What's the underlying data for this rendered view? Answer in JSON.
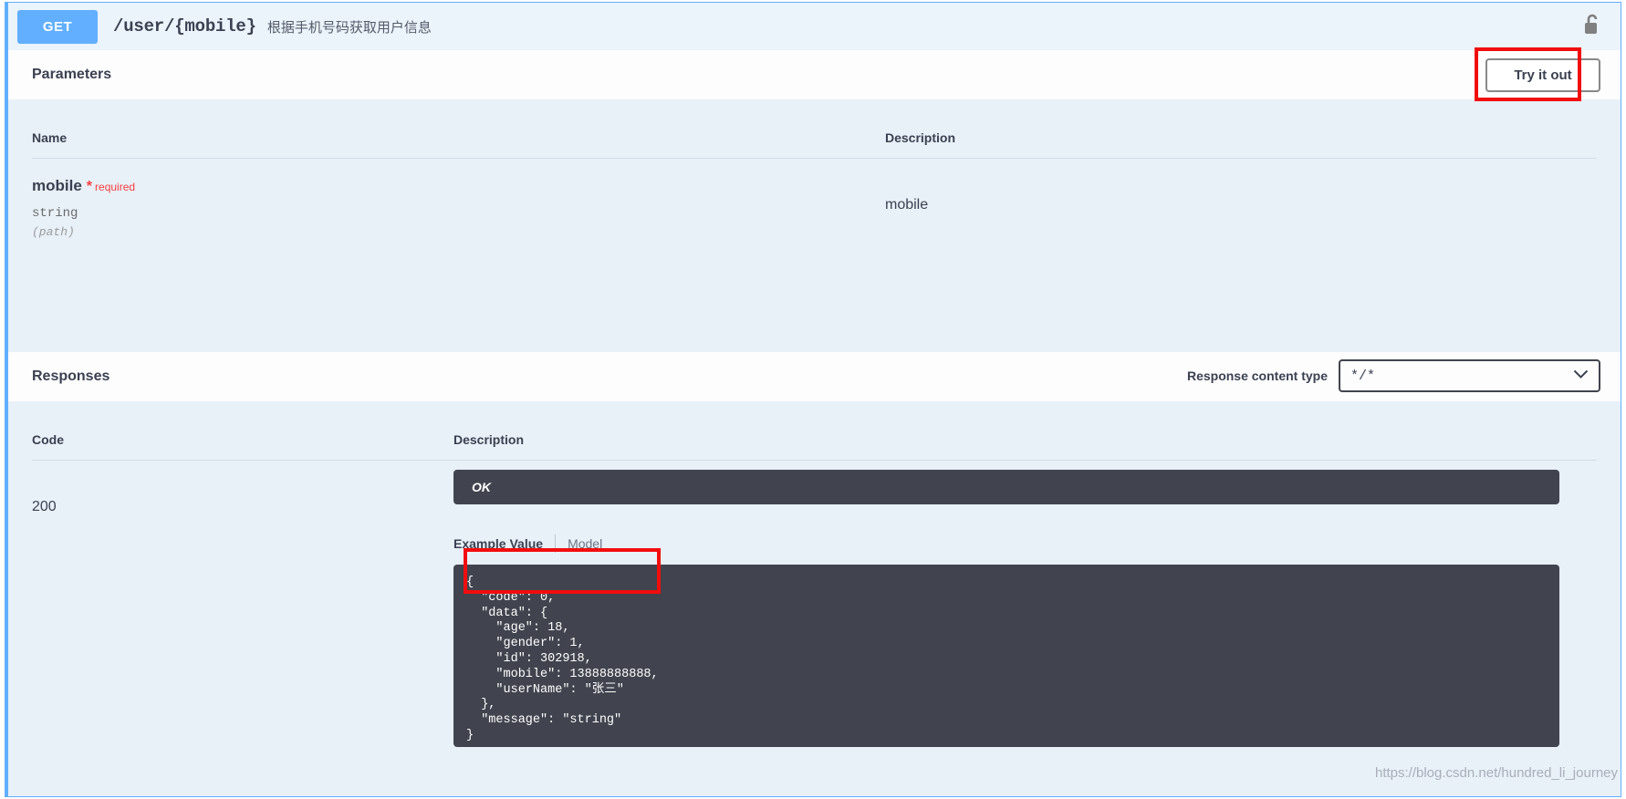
{
  "operation": {
    "method": "GET",
    "path": "/user/{mobile}",
    "summary": "根据手机号码获取用户信息",
    "lock_icon": "unlocked-padlock-icon",
    "method_color": "#61affe"
  },
  "parameters": {
    "section_title": "Parameters",
    "try_it_out_label": "Try it out",
    "columns": {
      "name": "Name",
      "description": "Description"
    },
    "rows": [
      {
        "name": "mobile",
        "required_star": "*",
        "required_label": "required",
        "type": "string",
        "location": "(path)",
        "description": "mobile"
      }
    ]
  },
  "responses": {
    "section_title": "Responses",
    "content_type_label": "Response content type",
    "content_type_value": "*/*",
    "content_type_options": [
      "*/*"
    ],
    "chevron_icon": "chevron-down-icon",
    "columns": {
      "code": "Code",
      "description": "Description"
    },
    "rows": [
      {
        "code": "200",
        "description": "OK",
        "tabs": {
          "example_value": "Example Value",
          "model": "Model",
          "active": "Example Value"
        },
        "example_json": "{\n  \"code\": 0,\n  \"data\": {\n    \"age\": 18,\n    \"gender\": 1,\n    \"id\": 302918,\n    \"mobile\": 13888888888,\n    \"userName\": \"张三\"\n  },\n  \"message\": \"string\"\n}"
      }
    ]
  },
  "annotations": {
    "color": "#f20d0d",
    "boxes": [
      "try-it-out-button",
      "example-value-model-tabs"
    ]
  },
  "watermark": "https://blog.csdn.net/hundred_li_journey"
}
